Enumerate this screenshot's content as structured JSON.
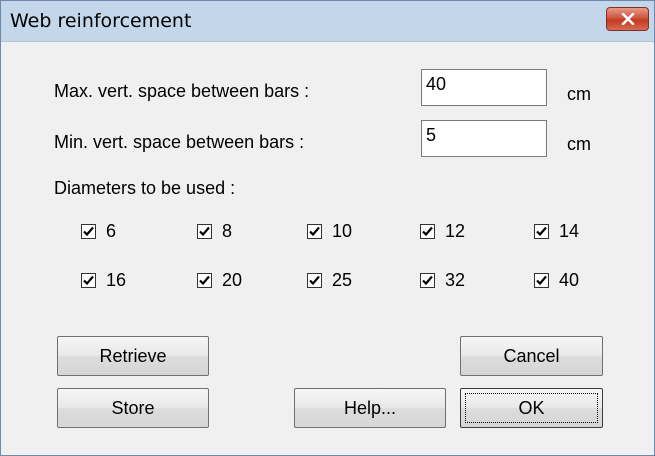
{
  "window": {
    "title": "Web reinforcement"
  },
  "fields": {
    "max_vert_space": {
      "label": "Max. vert. space between bars :",
      "value": "40",
      "unit": "cm"
    },
    "min_vert_space": {
      "label": "Min. vert. space between bars :",
      "value": "5",
      "unit": "cm"
    }
  },
  "diameters": {
    "label": "Diameters to be used :",
    "items": [
      {
        "value": "6",
        "checked": true
      },
      {
        "value": "8",
        "checked": true
      },
      {
        "value": "10",
        "checked": true
      },
      {
        "value": "12",
        "checked": true
      },
      {
        "value": "14",
        "checked": true
      },
      {
        "value": "16",
        "checked": true
      },
      {
        "value": "20",
        "checked": true
      },
      {
        "value": "25",
        "checked": true
      },
      {
        "value": "32",
        "checked": true
      },
      {
        "value": "40",
        "checked": true
      }
    ]
  },
  "buttons": {
    "retrieve": "Retrieve",
    "store": "Store",
    "help": "Help...",
    "cancel": "Cancel",
    "ok": "OK"
  },
  "icons": {
    "close": "close-icon",
    "check": "check-icon"
  },
  "colors": {
    "titlebar": "#c4d6ea",
    "close_button": "#c2391f",
    "dialog_bg": "#f0f0f0"
  }
}
